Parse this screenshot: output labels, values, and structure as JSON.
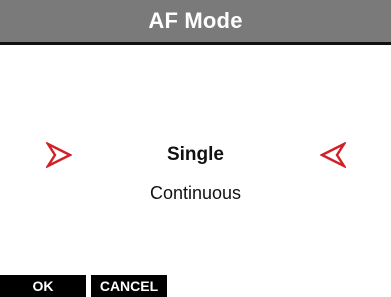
{
  "dialog": {
    "title": "AF Mode"
  },
  "options": {
    "selected": "Single",
    "other": "Continuous"
  },
  "navigation": {
    "left_icon": "chevron-right-outline-icon",
    "right_icon": "chevron-left-outline-icon",
    "arrow_color": "#d41f26"
  },
  "softkeys": {
    "ok_label": "OK",
    "cancel_label": "CANCEL"
  },
  "colors": {
    "title_bar": "#7a7a7a",
    "title_text": "#ffffff",
    "softkey_bg": "#000000"
  }
}
